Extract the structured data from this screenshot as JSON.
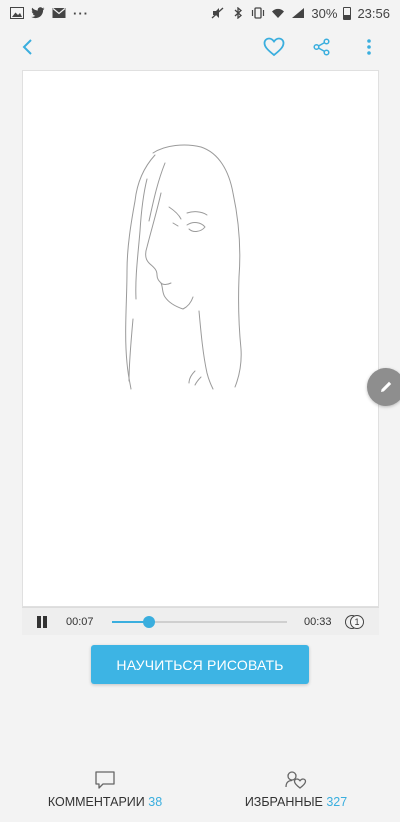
{
  "status_bar": {
    "battery": "30%",
    "time": "23:56",
    "left_icons": [
      "gallery-icon",
      "twitter-icon",
      "mail-icon",
      "more-dots-icon"
    ],
    "right_icons": [
      "mute-icon",
      "bluetooth-icon",
      "vibrate-icon",
      "wifi-icon",
      "signal-icon",
      "battery-icon"
    ]
  },
  "app_bar": {
    "icons": [
      "back-arrow-icon",
      "heart-icon",
      "share-icon",
      "overflow-menu-icon"
    ],
    "accent": "#3aaede"
  },
  "player": {
    "current_time": "00:07",
    "total_time": "00:33",
    "progress": 0.21,
    "speed": "1"
  },
  "learn_button": {
    "label": "НАУЧИТЬСЯ РИСОВАТЬ",
    "color": "#3db4e4"
  },
  "bottom_bar": {
    "comments": {
      "label": "КОММЕНТАРИИ",
      "count": "38"
    },
    "favorites": {
      "label": "ИЗБРАННЫЕ",
      "count": "327"
    }
  }
}
